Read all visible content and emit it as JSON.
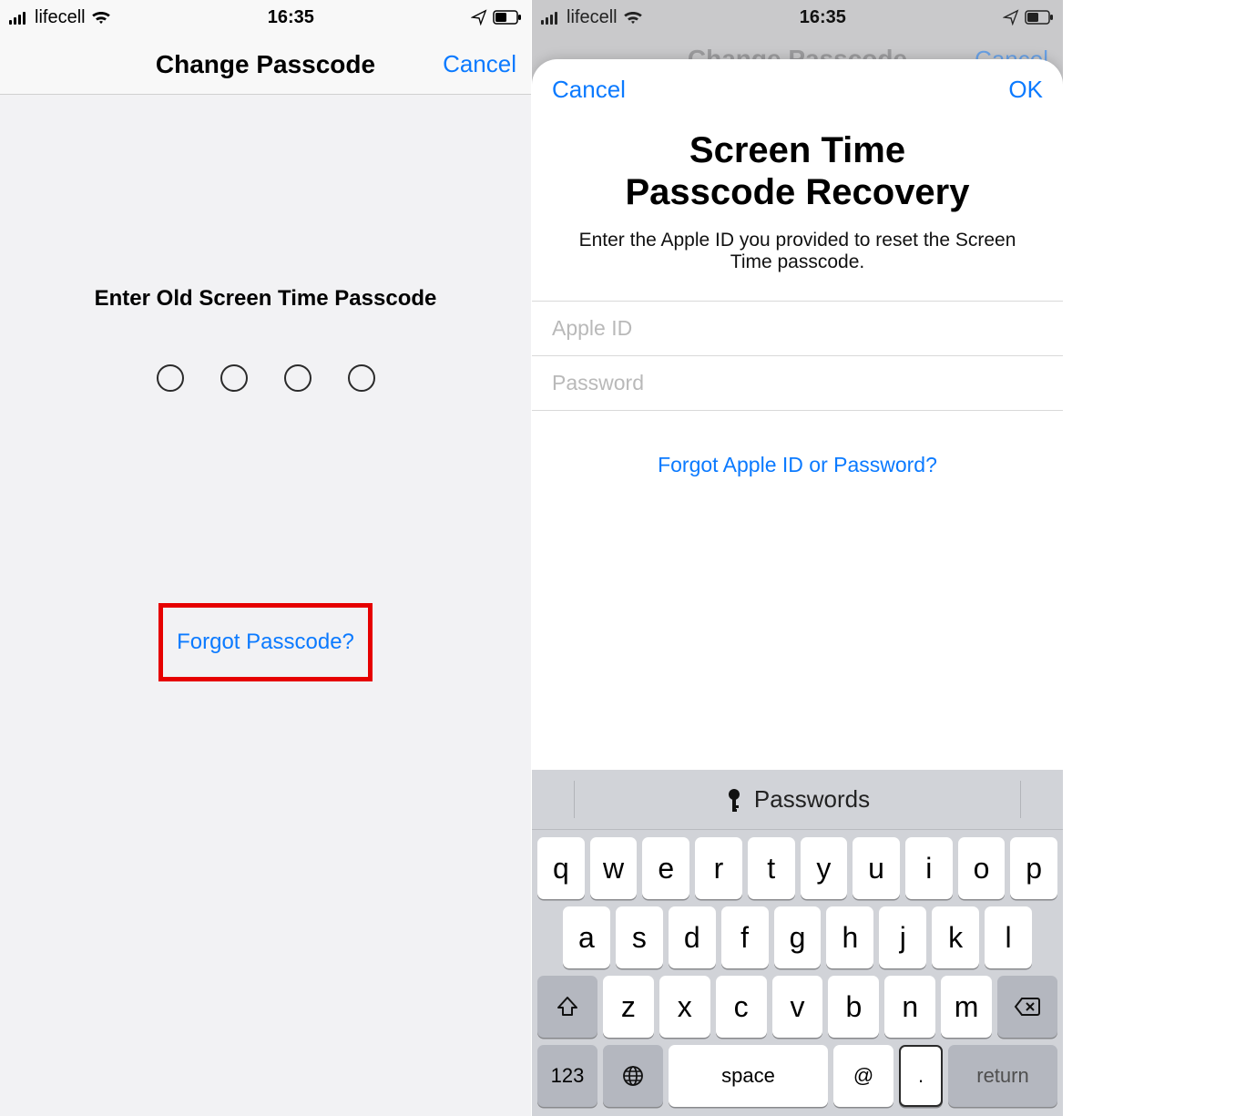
{
  "status": {
    "carrier": "lifecell",
    "time": "16:35"
  },
  "left": {
    "title": "Change Passcode",
    "cancel": "Cancel",
    "prompt": "Enter Old Screen Time Passcode",
    "forgot": "Forgot Passcode?"
  },
  "right": {
    "bg_title": "Change Passcode",
    "bg_cancel": "Cancel",
    "sheet": {
      "cancel": "Cancel",
      "ok": "OK",
      "title_l1": "Screen Time",
      "title_l2": "Passcode Recovery",
      "subtitle": "Enter the Apple ID you provided to reset the Screen Time passcode.",
      "apple_id_placeholder": "Apple ID",
      "password_placeholder": "Password",
      "forgot": "Forgot Apple ID or Password?"
    },
    "keyboard": {
      "suggestion": "Passwords",
      "rows": {
        "r1": [
          "q",
          "w",
          "e",
          "r",
          "t",
          "y",
          "u",
          "i",
          "o",
          "p"
        ],
        "r2": [
          "a",
          "s",
          "d",
          "f",
          "g",
          "h",
          "j",
          "k",
          "l"
        ],
        "r3": [
          "z",
          "x",
          "c",
          "v",
          "b",
          "n",
          "m"
        ]
      },
      "k123": "123",
      "space": "space",
      "at": "@",
      "dot": ".",
      "ret": "return"
    }
  }
}
